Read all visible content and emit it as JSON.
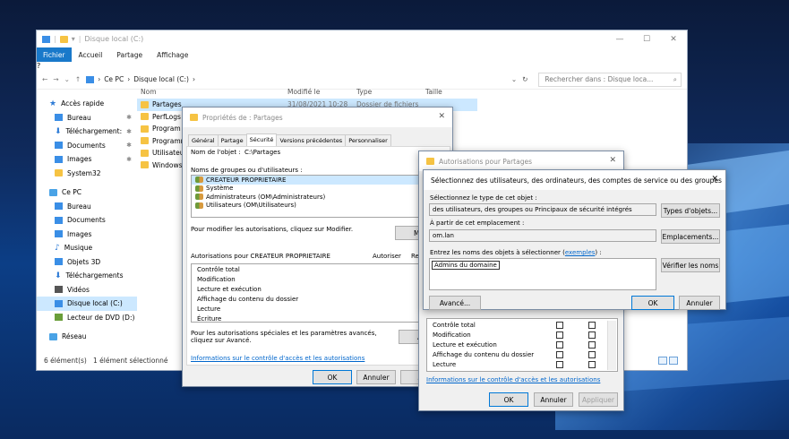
{
  "explorer": {
    "title": "Disque local (C:)",
    "ribbon_tabs": [
      "Fichier",
      "Accueil",
      "Partage",
      "Affichage"
    ],
    "breadcrumb": [
      "Ce PC",
      "Disque local (C:)"
    ],
    "search_placeholder": "Rechercher dans : Disque loca...",
    "columns": {
      "name": "Nom",
      "modified": "Modifié le",
      "type": "Type",
      "size": "Taille"
    },
    "files": [
      {
        "name": "Partages",
        "modified": "31/08/2021 10:28",
        "type": "Dossier de fichiers",
        "selected": true
      },
      {
        "name": "PerfLogs",
        "modified": "",
        "type": "",
        "selected": false
      },
      {
        "name": "Program F",
        "modified": "",
        "type": "",
        "selected": false
      },
      {
        "name": "Programm",
        "modified": "",
        "type": "",
        "selected": false
      },
      {
        "name": "Utilisateur",
        "modified": "",
        "type": "",
        "selected": false
      },
      {
        "name": "Windows",
        "modified": "",
        "type": "",
        "selected": false
      }
    ],
    "nav": {
      "quick_access": "Accès rapide",
      "quick_items": [
        "Bureau",
        "Téléchargement:",
        "Documents",
        "Images",
        "System32"
      ],
      "this_pc": "Ce PC",
      "pc_items": [
        "Bureau",
        "Documents",
        "Images",
        "Musique",
        "Objets 3D",
        "Téléchargements",
        "Vidéos",
        "Disque local (C:)",
        "Lecteur de DVD (D:)"
      ],
      "network": "Réseau"
    },
    "status_count": "6 élément(s)",
    "status_selected": "1 élément sélectionné"
  },
  "props": {
    "title": "Propriétés de : Partages",
    "tabs": [
      "Général",
      "Partage",
      "Sécurité",
      "Versions précédentes",
      "Personnaliser"
    ],
    "object_label": "Nom de l'objet :",
    "object_value": "C:\\Partages",
    "groups_label": "Noms de groupes ou d'utilisateurs :",
    "groups": [
      "CREATEUR PROPRIETAIRE",
      "Système",
      "Administrateurs (OM\\Administrateurs)",
      "Utilisateurs (OM\\Utilisateurs)"
    ],
    "modify_hint": "Pour modifier les autorisations, cliquez sur Modifier.",
    "modify_button": "Modi",
    "perm_header": "Autorisations pour CREATEUR PROPRIETAIRE",
    "allow": "Autoriser",
    "deny": "Refu",
    "perms": [
      "Contrôle total",
      "Modification",
      "Lecture et exécution",
      "Affichage du contenu du dossier",
      "Lecture",
      "Écriture"
    ],
    "special_hint": "Pour les autorisations spéciales et les paramètres avancés, cliquez sur Avancé.",
    "advanced_button": "Ava",
    "info_link": "Informations sur le contrôle d'accès et les autorisations",
    "ok": "OK",
    "cancel": "Annuler",
    "apply": "A"
  },
  "permsbg": {
    "title": "Autorisations pour Partages",
    "perms": [
      "Contrôle total",
      "Modification",
      "Lecture et exécution",
      "Affichage du contenu du dossier",
      "Lecture"
    ],
    "info_link": "Informations sur le contrôle d'accès et les autorisations",
    "ok": "OK",
    "cancel": "Annuler",
    "apply": "Appliquer"
  },
  "selusr": {
    "title": "Sélectionnez des utilisateurs, des ordinateurs, des comptes de service ou des groupes",
    "type_label": "Sélectionnez le type de cet objet :",
    "type_value": "des utilisateurs, des groupes ou Principaux de sécurité intégrés",
    "type_button": "Types d'objets...",
    "location_label": "À partir de cet emplacement :",
    "location_value": "om.lan",
    "location_button": "Emplacements...",
    "names_label": "Entrez les noms des objets à sélectionner (",
    "names_link": "exemples",
    "names_label_end": ") :",
    "names_value": "Admins du domaine",
    "check_button": "Vérifier les noms",
    "advanced_button": "Avancé...",
    "ok": "OK",
    "cancel": "Annuler"
  }
}
